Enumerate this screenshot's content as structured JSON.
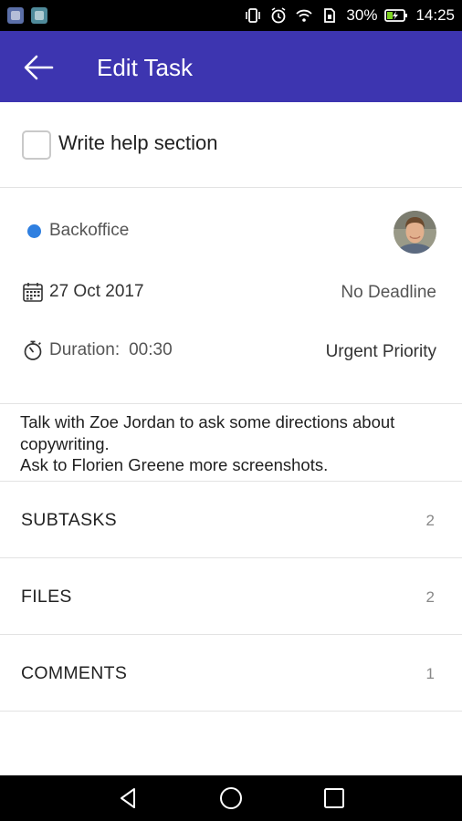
{
  "status_bar": {
    "battery": "30%",
    "time": "14:25"
  },
  "app_bar": {
    "title": "Edit Task",
    "color": "#3d35b0"
  },
  "task": {
    "title": "Write help section",
    "done": false
  },
  "meta": {
    "project": "Backoffice",
    "project_color": "#2f7fe0",
    "date": "27 Oct 2017",
    "deadline": "No Deadline",
    "duration_label": "Duration:",
    "duration_value": "00:30",
    "priority": "Urgent Priority"
  },
  "notes": [
    "Talk with Zoe Jordan to ask some directions about",
    "copywriting.",
    "Ask to Florien Greene more screenshots."
  ],
  "sections": [
    {
      "label": "SUBTASKS",
      "count": "2"
    },
    {
      "label": "FILES",
      "count": "2"
    },
    {
      "label": "COMMENTS",
      "count": "1"
    }
  ]
}
